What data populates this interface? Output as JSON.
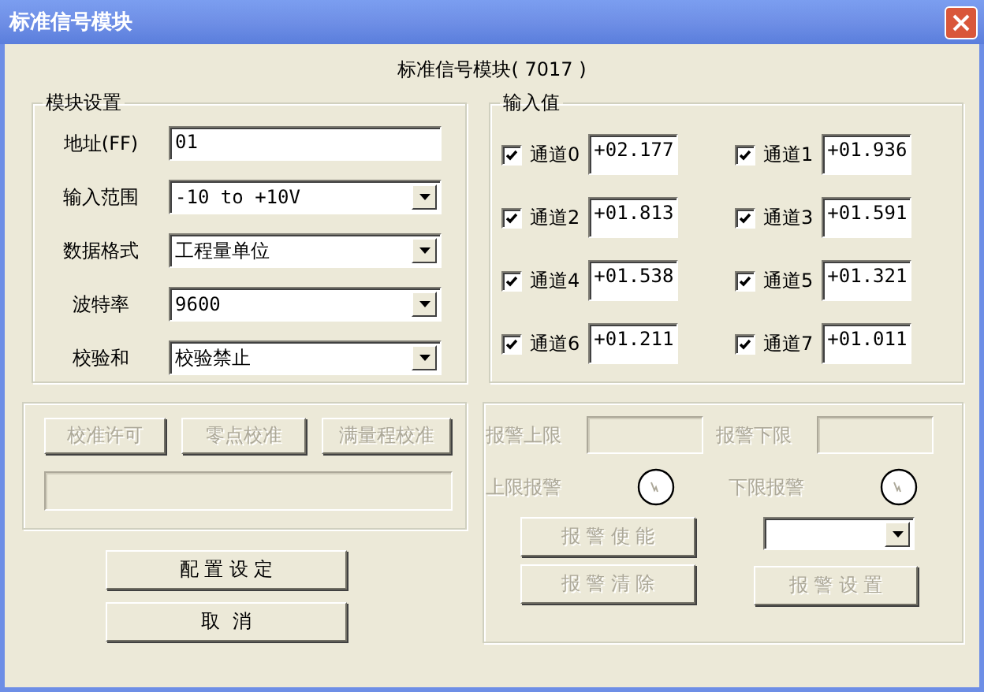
{
  "window": {
    "title": "标准信号模块"
  },
  "header": "标准信号模块( 7017  )",
  "module_settings": {
    "title": "模块设置",
    "fields": [
      {
        "label": "地址(FF)",
        "value": "01",
        "kind": "text"
      },
      {
        "label": "输入范围",
        "value": "-10 to +10V",
        "kind": "dropdown"
      },
      {
        "label": "数据格式",
        "value": "工程量单位",
        "kind": "dropdown"
      },
      {
        "label": "波特率",
        "value": "9600",
        "kind": "dropdown"
      },
      {
        "label": "校验和",
        "value": "校验禁止",
        "kind": "dropdown"
      }
    ]
  },
  "input_values": {
    "title": "输入值",
    "channels": [
      {
        "label": "通道0",
        "checked": true,
        "value": "+02.177"
      },
      {
        "label": "通道1",
        "checked": true,
        "value": "+01.936"
      },
      {
        "label": "通道2",
        "checked": true,
        "value": "+01.813"
      },
      {
        "label": "通道3",
        "checked": true,
        "value": "+01.591"
      },
      {
        "label": "通道4",
        "checked": true,
        "value": "+01.538"
      },
      {
        "label": "通道5",
        "checked": true,
        "value": "+01.321"
      },
      {
        "label": "通道6",
        "checked": true,
        "value": "+01.211"
      },
      {
        "label": "通道7",
        "checked": true,
        "value": "+01.011"
      }
    ]
  },
  "calibration": {
    "buttons": [
      {
        "label": "校准许可",
        "disabled": true
      },
      {
        "label": "零点校准",
        "disabled": true
      },
      {
        "label": "满量程校准",
        "disabled": true
      }
    ]
  },
  "actions": [
    "配 置 设 定",
    "取  消"
  ],
  "alarm": {
    "limits": [
      {
        "label": "报警上限",
        "disabled": true
      },
      {
        "label": "报警下限",
        "disabled": true
      }
    ],
    "indicators": [
      {
        "label": "上限报警",
        "disabled": true
      },
      {
        "label": "下限报警",
        "disabled": true
      }
    ],
    "left_buttons": [
      {
        "label": "报 警 使 能",
        "disabled": true
      },
      {
        "label": "报 警 清 除",
        "disabled": true
      }
    ],
    "set_button": {
      "label": "报 警 设 置",
      "disabled": true
    }
  }
}
